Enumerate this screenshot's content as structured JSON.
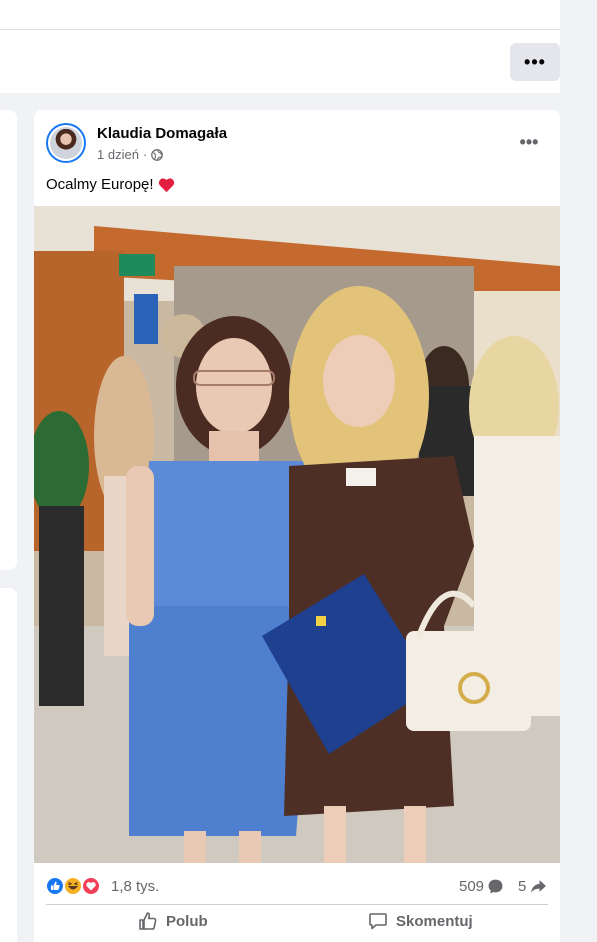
{
  "header": {
    "more_label": "•••"
  },
  "post": {
    "author": "Klaudia Domagała",
    "time": "1 dzień",
    "separator": "·",
    "privacy_icon": "globe-icon",
    "more_label": "•••",
    "text": "Ocalmy Europę!",
    "text_emoji": "red-heart-icon",
    "photo_icon": "post-photo",
    "reactions": {
      "icons": [
        "like-icon",
        "haha-icon",
        "love-icon"
      ],
      "count": "1,8 tys."
    },
    "comments_count": "509",
    "shares_count": "5",
    "actions": {
      "like_label": "Polub",
      "comment_label": "Skomentuj"
    }
  },
  "colors": {
    "background": "#f0f2f5",
    "card": "#ffffff",
    "secondary_text": "#65676b",
    "accent": "#1877f2",
    "heart": "#e41e3f"
  }
}
